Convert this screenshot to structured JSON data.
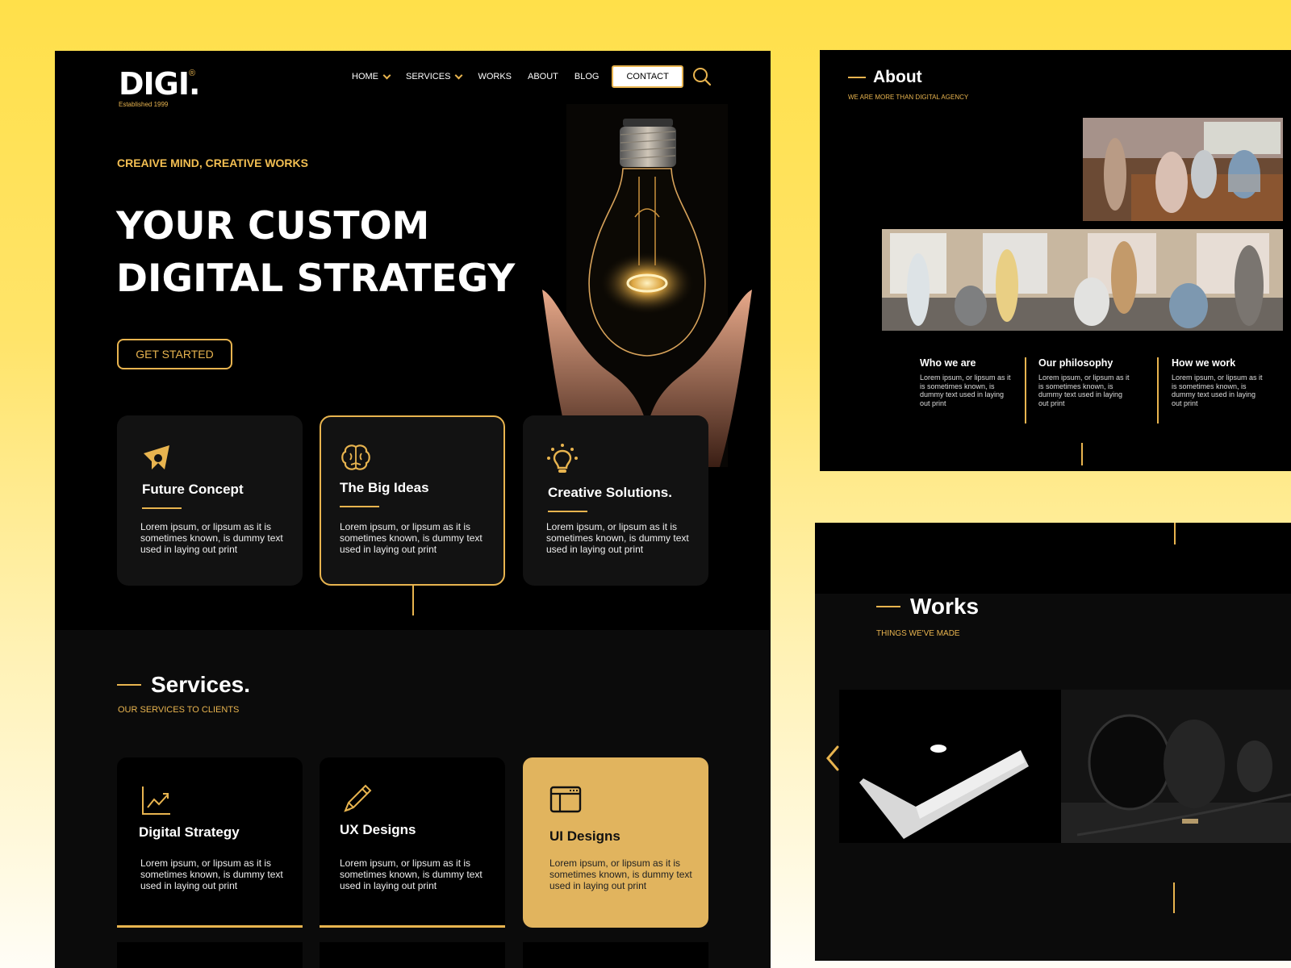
{
  "colors": {
    "accent": "#e8b44f",
    "card_active": "#e1b45e",
    "background_black": "#000000",
    "card_dark": "#121212"
  },
  "header": {
    "logo_text": "DIGI.",
    "logo_mark": "®",
    "logo_subtitle": "Established 1999",
    "nav": [
      {
        "label": "HOME",
        "dropdown": true
      },
      {
        "label": "SERVICES",
        "dropdown": true
      },
      {
        "label": "WORKS",
        "dropdown": false
      },
      {
        "label": "ABOUT",
        "dropdown": false
      },
      {
        "label": "BLOG",
        "dropdown": false
      }
    ],
    "contact_label": "CONTACT",
    "search_icon": "search-icon"
  },
  "hero": {
    "tagline": "CREAIVE MIND, CREATIVE WORKS",
    "title_line1": "YOUR CUSTOM",
    "title_line2": "DIGITAL STRATEGY",
    "cta_label": "GET STARTED",
    "image": "light-bulb-in-hands"
  },
  "features": [
    {
      "icon": "paper-plane-icon",
      "title": "Future Concept",
      "desc": "Lorem ipsum, or lipsum as it is sometimes known, is dummy text used in laying out print",
      "active": false
    },
    {
      "icon": "brain-icon",
      "title": "The Big Ideas",
      "desc": "Lorem ipsum, or lipsum as it is sometimes known, is dummy text used in laying out print",
      "active": true
    },
    {
      "icon": "lightbulb-icon",
      "title": "Creative Solutions.",
      "desc": "Lorem ipsum, or lipsum as it is sometimes known, is dummy text used in laying out print",
      "active": false
    }
  ],
  "services": {
    "title": "Services.",
    "subtitle": "OUR SERVICES TO CLIENTS",
    "items": [
      {
        "icon": "chart-trend-icon",
        "title": "Digital Strategy",
        "desc": "Lorem ipsum, or lipsum as it is sometimes known, is dummy text used in laying out print",
        "active": false
      },
      {
        "icon": "pencil-icon",
        "title": "UX Designs",
        "desc": "Lorem ipsum, or lipsum as it is sometimes known, is dummy text used in laying out print",
        "active": false
      },
      {
        "icon": "browser-window-icon",
        "title": "UI Designs",
        "desc": "Lorem ipsum, or lipsum as it is sometimes known, is dummy text used in laying out print",
        "active": true
      }
    ]
  },
  "about": {
    "title": "About",
    "subtitle": "WE ARE MORE THAN DIGITAL AGENCY",
    "columns": [
      {
        "title": "Who we are",
        "desc": "Lorem ipsum, or lipsum as it is sometimes known, is dummy text used in laying out print"
      },
      {
        "title": "Our philosophy",
        "desc": "Lorem ipsum, or lipsum as it is sometimes known, is dummy text used in laying out print"
      },
      {
        "title": "How we work",
        "desc": "Lorem ipsum, or lipsum as it is sometimes known, is dummy text used in laying out print"
      }
    ]
  },
  "works": {
    "title": "Works",
    "subtitle": "THINGS WE'VE MADE",
    "items": [
      {
        "image": "laptop-photo"
      },
      {
        "image": "headphones-photo"
      }
    ]
  }
}
